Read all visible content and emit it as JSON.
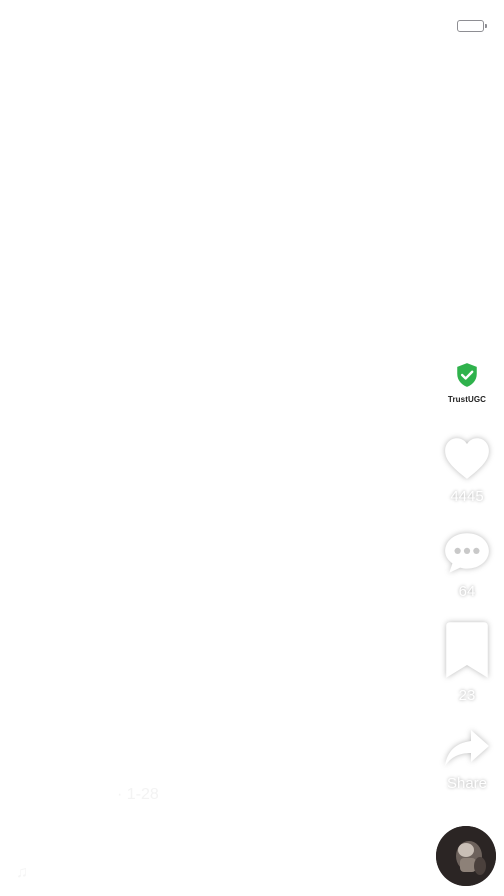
{
  "status_bar": {
    "battery_icon": "battery-icon"
  },
  "overlay_text": {
    "left": "",
    "mid1": "",
    "mid2": "",
    "mid3": "",
    "right1": "",
    "right2": "",
    "right3": ""
  },
  "rail": {
    "trust_label": "TrustUGC",
    "likes": "4445",
    "comments": "64",
    "saves": "23",
    "share_label": "Share"
  },
  "caption": {
    "author": "",
    "date": "· 1-28",
    "line1": "",
    "line2": "",
    "music": ""
  },
  "colors": {
    "trust_green": "#2fb24c",
    "icon_white": "#ffffff",
    "avatar_bg": "#2b2524"
  }
}
